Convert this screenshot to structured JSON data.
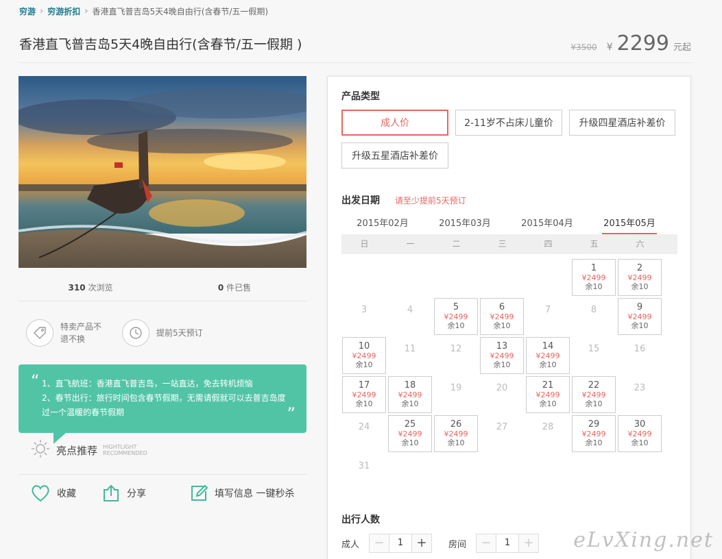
{
  "breadcrumb": {
    "items": [
      "穷游",
      "穷游折扣",
      "香港直飞普吉岛5天4晚自由行(含春节/五一假期)"
    ]
  },
  "product": {
    "title": "香港直飞普吉岛5天4晚自由行(含春节/五一假期 )",
    "original_price": "¥3500",
    "currency": "¥",
    "price": "2299",
    "price_suffix": "元起"
  },
  "stats": {
    "views": "310",
    "views_label": "次浏览",
    "sold": "0",
    "sold_label": "件已售"
  },
  "features": [
    {
      "icon": "tag-icon",
      "text": "特卖产品不退不换"
    },
    {
      "icon": "clock-icon",
      "text": "提前5天预订"
    }
  ],
  "highlight": {
    "lines": [
      "1、直飞航班：香港直飞普吉岛，一站直达，免去转机烦恼",
      "2、春节出行：旅行时间包含春节假期，无需请假就可以去普吉岛度过一个温暖的春节假期"
    ],
    "label": "亮点推荐",
    "label_en_1": "HIGHTLIGHT",
    "label_en_2": "RECOMMENDED"
  },
  "actions": {
    "favorite": "收藏",
    "share": "分享",
    "quick_buy": "填写信息 一键秒杀"
  },
  "booking": {
    "product_type_title": "产品类型",
    "product_types": [
      "成人价",
      "2-11岁不占床儿童价",
      "升级四星酒店补差价",
      "升级五星酒店补差价"
    ],
    "date_title": "出发日期",
    "date_tip": "请至少提前5天预订",
    "months": [
      "2015年02月",
      "2015年03月",
      "2015年04月",
      "2015年05月"
    ],
    "weekdays": [
      "日",
      "一",
      "二",
      "三",
      "四",
      "五",
      "六"
    ],
    "days": [
      {
        "day": "1",
        "col": 5,
        "row": 0,
        "available": true,
        "price": "¥2499",
        "remain": "余10"
      },
      {
        "day": "2",
        "col": 6,
        "row": 0,
        "available": true,
        "price": "¥2499",
        "remain": "余10"
      },
      {
        "day": "3",
        "col": 0,
        "row": 1,
        "available": false
      },
      {
        "day": "4",
        "col": 1,
        "row": 1,
        "available": false
      },
      {
        "day": "5",
        "col": 2,
        "row": 1,
        "available": true,
        "price": "¥2499",
        "remain": "余10"
      },
      {
        "day": "6",
        "col": 3,
        "row": 1,
        "available": true,
        "price": "¥2499",
        "remain": "余10"
      },
      {
        "day": "7",
        "col": 4,
        "row": 1,
        "available": false
      },
      {
        "day": "8",
        "col": 5,
        "row": 1,
        "available": false
      },
      {
        "day": "9",
        "col": 6,
        "row": 1,
        "available": true,
        "price": "¥2499",
        "remain": "余10"
      },
      {
        "day": "10",
        "col": 0,
        "row": 2,
        "available": true,
        "price": "¥2499",
        "remain": "余10"
      },
      {
        "day": "11",
        "col": 1,
        "row": 2,
        "available": false
      },
      {
        "day": "12",
        "col": 2,
        "row": 2,
        "available": false
      },
      {
        "day": "13",
        "col": 3,
        "row": 2,
        "available": true,
        "price": "¥2499",
        "remain": "余10"
      },
      {
        "day": "14",
        "col": 4,
        "row": 2,
        "available": true,
        "price": "¥2499",
        "remain": "余10"
      },
      {
        "day": "15",
        "col": 5,
        "row": 2,
        "available": false
      },
      {
        "day": "16",
        "col": 6,
        "row": 2,
        "available": false
      },
      {
        "day": "17",
        "col": 0,
        "row": 3,
        "available": true,
        "price": "¥2499",
        "remain": "余10"
      },
      {
        "day": "18",
        "col": 1,
        "row": 3,
        "available": true,
        "price": "¥2499",
        "remain": "余10"
      },
      {
        "day": "19",
        "col": 2,
        "row": 3,
        "available": false
      },
      {
        "day": "20",
        "col": 3,
        "row": 3,
        "available": false
      },
      {
        "day": "21",
        "col": 4,
        "row": 3,
        "available": true,
        "price": "¥2499",
        "remain": "余10"
      },
      {
        "day": "22",
        "col": 5,
        "row": 3,
        "available": true,
        "price": "¥2499",
        "remain": "余10"
      },
      {
        "day": "23",
        "col": 6,
        "row": 3,
        "available": false
      },
      {
        "day": "24",
        "col": 0,
        "row": 4,
        "available": false
      },
      {
        "day": "25",
        "col": 1,
        "row": 4,
        "available": true,
        "price": "¥2499",
        "remain": "余10"
      },
      {
        "day": "26",
        "col": 2,
        "row": 4,
        "available": true,
        "price": "¥2499",
        "remain": "余10"
      },
      {
        "day": "27",
        "col": 3,
        "row": 4,
        "available": false
      },
      {
        "day": "28",
        "col": 4,
        "row": 4,
        "available": false
      },
      {
        "day": "29",
        "col": 5,
        "row": 4,
        "available": true,
        "price": "¥2499",
        "remain": "余10"
      },
      {
        "day": "30",
        "col": 6,
        "row": 4,
        "available": true,
        "price": "¥2499",
        "remain": "余10"
      },
      {
        "day": "31",
        "col": 0,
        "row": 5,
        "available": false
      }
    ],
    "people_title": "出行人数",
    "adult_label": "成人",
    "adult_value": "1",
    "room_label": "房间",
    "room_value": "1",
    "minus": "−",
    "plus": "+"
  },
  "watermark": "eLvXing.net",
  "colors": {
    "accent": "#e8655f",
    "highlight_bg": "#52c4a6",
    "link": "#1a7a8c"
  }
}
